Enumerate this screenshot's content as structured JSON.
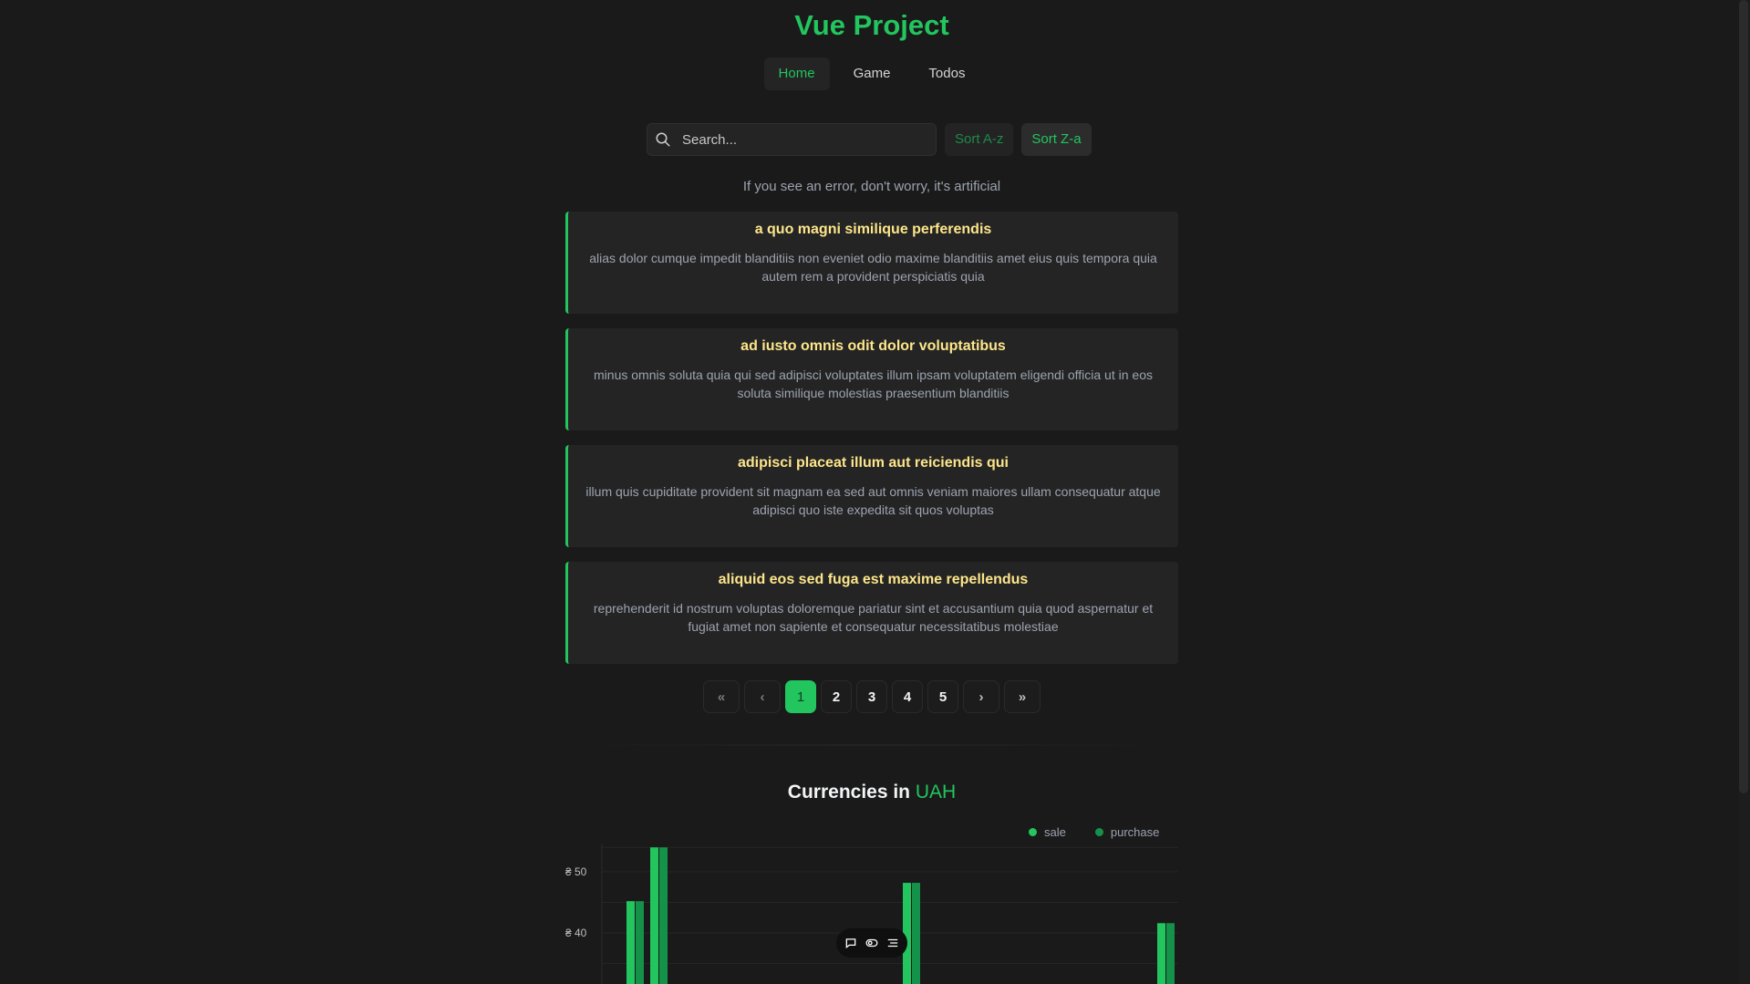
{
  "app": {
    "title": "Vue Project"
  },
  "nav": {
    "items": [
      {
        "label": "Home",
        "active": true
      },
      {
        "label": "Game",
        "active": false
      },
      {
        "label": "Todos",
        "active": false
      }
    ]
  },
  "search": {
    "placeholder": "Search...",
    "value": ""
  },
  "sort": {
    "asc_label": "Sort A-z",
    "desc_label": "Sort Z-a"
  },
  "note": "If you see an error, don't worry, it's artificial",
  "posts": [
    {
      "title": "a quo magni similique perferendis",
      "body": "alias dolor cumque impedit blanditiis non eveniet odio maxime blanditiis amet eius quis tempora quia autem rem a provident perspiciatis quia"
    },
    {
      "title": "ad iusto omnis odit dolor voluptatibus",
      "body": "minus omnis soluta quia qui sed adipisci voluptates illum ipsam voluptatem eligendi officia ut in eos soluta similique molestias praesentium blanditiis"
    },
    {
      "title": "adipisci placeat illum aut reiciendis qui",
      "body": "illum quis cupiditate provident sit magnam ea sed aut omnis veniam maiores ullam consequatur atque adipisci quo iste expedita sit quos voluptas"
    },
    {
      "title": "aliquid eos sed fuga est maxime repellendus",
      "body": "reprehenderit id nostrum voluptas doloremque pariatur sint et accusantium quia quod aspernatur et fugiat amet non sapiente et consequatur necessitatibus molestiae"
    }
  ],
  "pagination": {
    "first": "«",
    "prev": "‹",
    "pages": [
      "1",
      "2",
      "3",
      "4",
      "5"
    ],
    "current": "1",
    "next": "›",
    "last": "»"
  },
  "currencies": {
    "title_prefix": "Currencies in",
    "base": "UAH"
  },
  "colors": {
    "accent": "#22c55e",
    "sale": "#22c55e",
    "purchase": "#15924a",
    "post_title": "#fde68a"
  },
  "chart_data": {
    "type": "bar",
    "title": "Currencies in UAH",
    "ytick_labels": [
      "₴ 50",
      "₴ 40"
    ],
    "ytick_values": [
      50,
      40
    ],
    "ylim_visible": [
      32,
      55
    ],
    "series": [
      {
        "name": "sale",
        "color": "#22c55e"
      },
      {
        "name": "purchase",
        "color": "#15924a"
      }
    ],
    "groups": [
      {
        "sale": 45.2,
        "purchase": 45.2
      },
      {
        "sale": 54.0,
        "purchase": 54.0
      },
      {
        "sale": 48.2,
        "purchase": 48.2
      },
      {
        "sale": 41.6,
        "purchase": 41.6
      }
    ],
    "legend": "top-right",
    "grid": true
  }
}
